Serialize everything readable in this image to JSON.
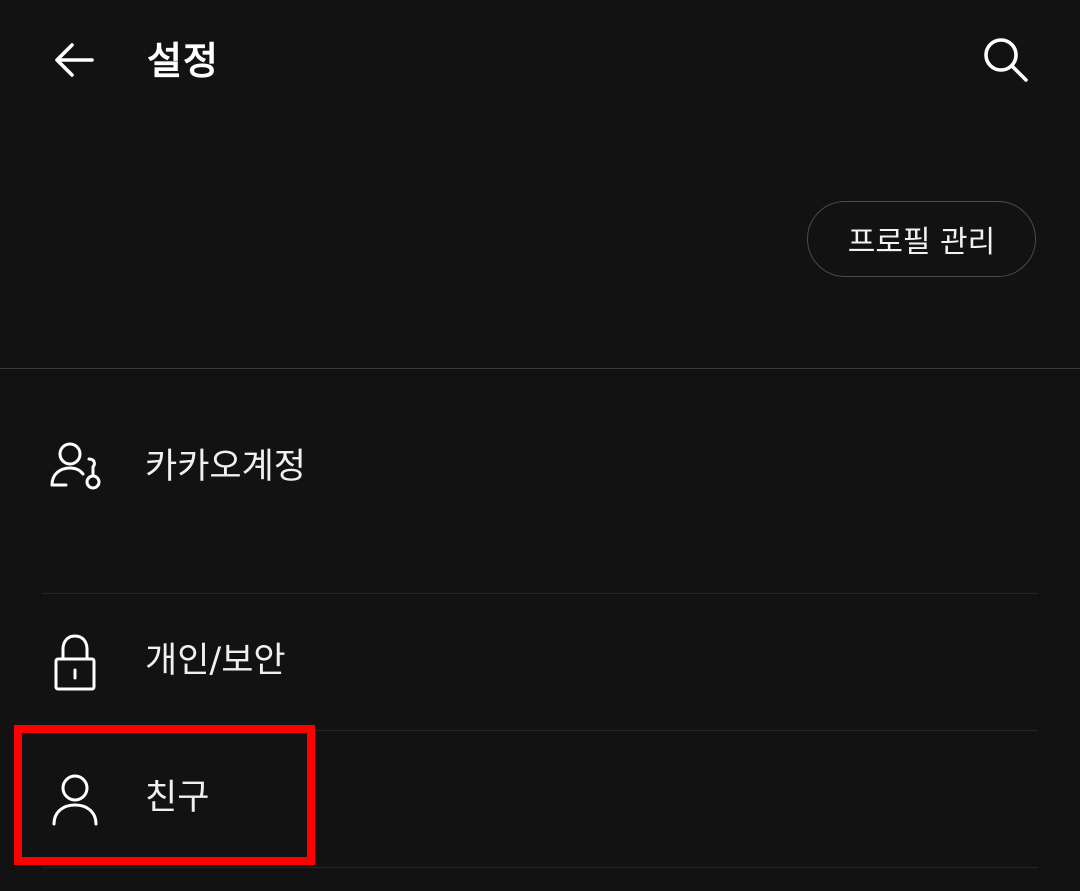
{
  "header": {
    "title": "설정",
    "back_icon": "arrow-left-icon",
    "search_icon": "search-icon"
  },
  "profile": {
    "manage_label": "프로필 관리"
  },
  "menu": {
    "items": [
      {
        "label": "카카오계정",
        "icon": "account-key-icon"
      },
      {
        "label": "개인/보안",
        "icon": "lock-icon"
      },
      {
        "label": "친구",
        "icon": "person-icon"
      }
    ]
  },
  "highlight": {
    "color": "#ff0000",
    "target": "친구"
  },
  "colors": {
    "background": "#121212",
    "text": "#ffffff",
    "divider": "#3a3a3a"
  }
}
